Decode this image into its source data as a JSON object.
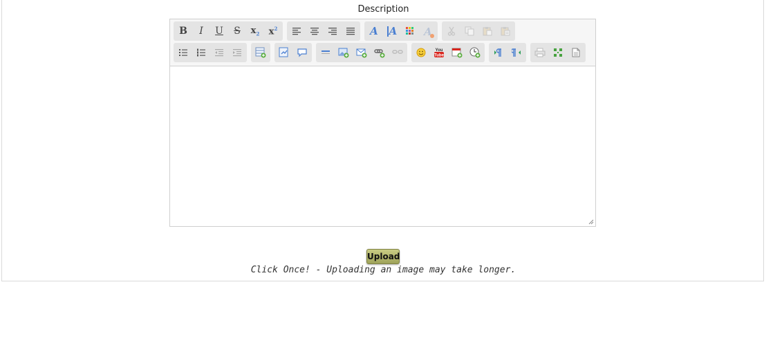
{
  "form": {
    "description_label": "Description",
    "upload_label": "Upload",
    "note": "Click Once! - Uploading an image may take longer."
  },
  "toolbar": {
    "bold": "B",
    "italic": "I",
    "underline": "U",
    "strike": "S",
    "subscript": "x",
    "superscript": "x",
    "font_color": "A",
    "bg_color": "A",
    "remove_format": "A"
  },
  "colors": {
    "accent_blue": "#4a7fd1",
    "upload_button": "#b4b86e",
    "youtube_red": "#d9251d"
  }
}
